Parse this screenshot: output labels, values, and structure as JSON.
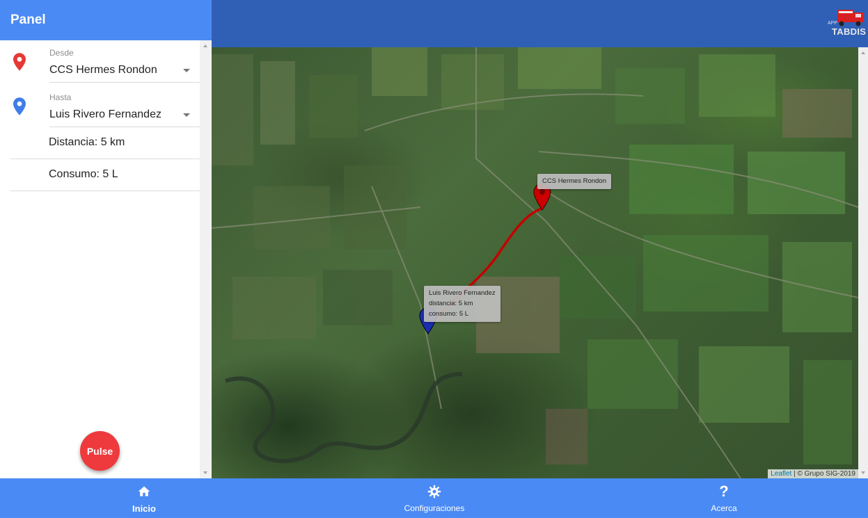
{
  "panel": {
    "title": "Panel",
    "from": {
      "caption": "Desde",
      "value": "CCS Hermes Rondon",
      "icon": "location-pin-icon",
      "color": "#e53935"
    },
    "to": {
      "caption": "Hasta",
      "value": "Luis Rivero Fernandez",
      "icon": "location-pin-icon",
      "color": "#3f7ee8"
    },
    "distance": "Distancia: 5 km",
    "consumption": "Consumo: 5 L",
    "fab_label": "Pulse"
  },
  "topbar": {
    "logo_small": "APP",
    "logo_text": "TABDIS"
  },
  "map": {
    "from_tooltip": "CCS Hermes Rondon",
    "to_tooltip": {
      "name": "Luis Rivero Fernandez",
      "distance": "distancia: 5 km",
      "consumption": "consumo: 5 L"
    },
    "attribution_link": "Leaflet",
    "attribution_text": " | © Grupo SIG-2019",
    "route_color": "#c40000",
    "from_marker_color": "#cc0000",
    "to_marker_color": "#1a2fb0"
  },
  "bottomnav": {
    "items": [
      {
        "label": "Inicio",
        "icon": "home-icon"
      },
      {
        "label": "Configuraciones",
        "icon": "gear-icon"
      },
      {
        "label": "Acerca",
        "icon": "question-icon",
        "glyph": "?"
      }
    ]
  },
  "colors": {
    "primary": "#4a8af4",
    "topbar": "#3060b5",
    "fab": "#ee3a3d"
  }
}
